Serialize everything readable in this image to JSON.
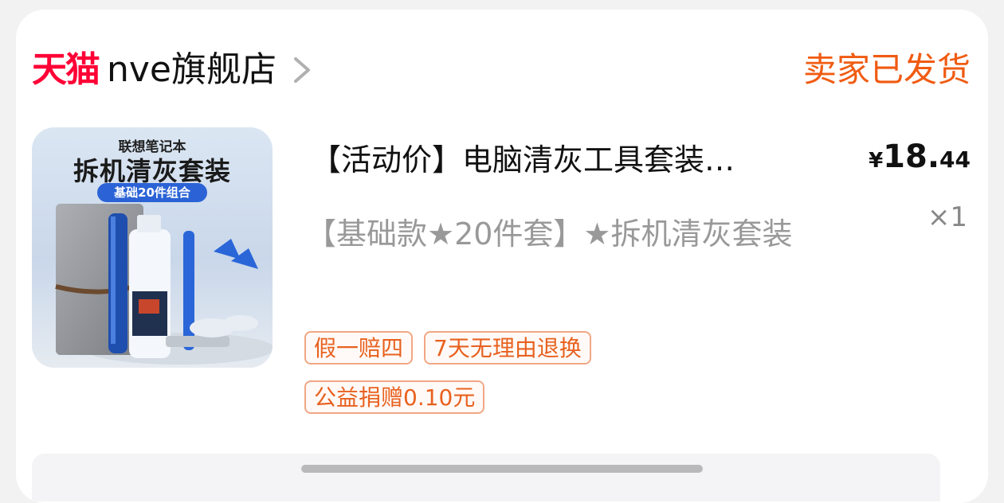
{
  "store": {
    "platform": "天猫",
    "name": "nve旗舰店"
  },
  "order": {
    "status": "卖家已发货"
  },
  "product": {
    "image": {
      "brand_line": "联想笔记本",
      "headline": "拆机清灰套装",
      "pill": "基础20件组合"
    },
    "title": "【活动价】电脑清灰工具套装…",
    "price": {
      "currency": "¥",
      "integer": "18.",
      "decimal": "44"
    },
    "quantity": "×1",
    "variant": "【基础款★20件套】★拆机清灰套装",
    "tags": [
      "假一赔四",
      "7天无理由退换"
    ],
    "charity": "公益捐赠0.10元"
  },
  "colors": {
    "tmall_red": "#ff0036",
    "status_orange": "#f05b12",
    "tag_orange": "#e8611f"
  }
}
